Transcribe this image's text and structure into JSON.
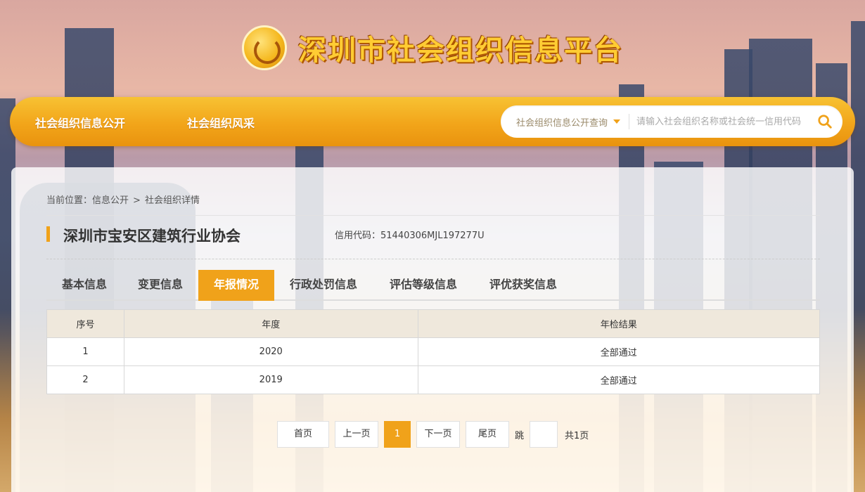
{
  "site": {
    "title": "深圳市社会组织信息平台",
    "logo_icon": "org-emblem-icon"
  },
  "nav": {
    "items": [
      {
        "label": "社会组织信息公开"
      },
      {
        "label": "社会组织风采"
      }
    ]
  },
  "search": {
    "category": "社会组织信息公开查询",
    "placeholder": "请输入社会组织名称或社会统一信用代码",
    "value": ""
  },
  "breadcrumb": {
    "prefix": "当前位置：",
    "items": [
      "信息公开",
      "社会组织详情"
    ],
    "separator": ">"
  },
  "org": {
    "name": "深圳市宝安区建筑行业协会",
    "credit_code": "信用代码：51440306MJL197277U"
  },
  "tabs": [
    {
      "label": "基本信息"
    },
    {
      "label": "变更信息"
    },
    {
      "label": "年报情况",
      "active": true
    },
    {
      "label": "行政处罚信息"
    },
    {
      "label": "评估等级信息"
    },
    {
      "label": "评优获奖信息"
    }
  ],
  "table": {
    "headers": [
      "序号",
      "年度",
      "年检结果"
    ],
    "rows": [
      [
        "1",
        "2020",
        "全部通过"
      ],
      [
        "2",
        "2019",
        "全部通过"
      ]
    ]
  },
  "pagination": {
    "first": "首页",
    "prev": "上一页",
    "current": "1",
    "next": "下一页",
    "last": "尾页",
    "jump_label": "跳",
    "jump_value": "",
    "total": "共1页"
  },
  "colors": {
    "accent": "#f0a21a",
    "title": "#ffcc33"
  }
}
